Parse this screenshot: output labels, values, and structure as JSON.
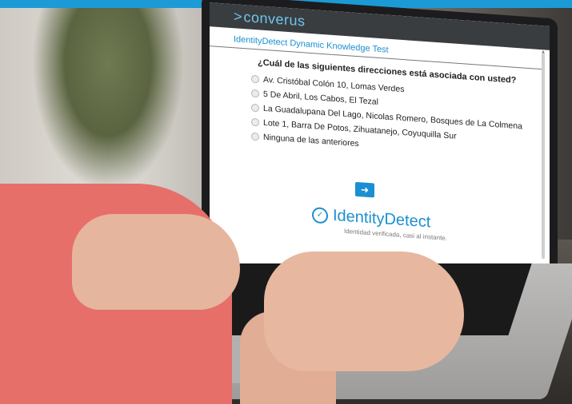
{
  "app": {
    "logo_caret": ">",
    "logo_text": "converus",
    "title": "IdentityDetect Dynamic Knowledge Test"
  },
  "quiz": {
    "question": "¿Cuál de las siguientes direcciones está asociada con usted?",
    "options": [
      "Av. Cristóbal Colón 10, Lomas Verdes",
      "5 De Abril, Los Cabos, El Tezal",
      "La Guadalupana Del Lago, Nicolas Romero, Bosques de La Colmena",
      "Lote 1, Barra De Potos, Zihuatanejo, Coyuquilla Sur",
      "Ninguna de las anteriores"
    ],
    "next_button_icon": "arrow-right-icon"
  },
  "brand": {
    "name": "IdentityDetect",
    "tagline": "Identidad verificada, casi al instante."
  },
  "colors": {
    "top_bar": "#1b9ad6",
    "accent": "#1b8fd0",
    "header_bg": "#3a3d40"
  }
}
